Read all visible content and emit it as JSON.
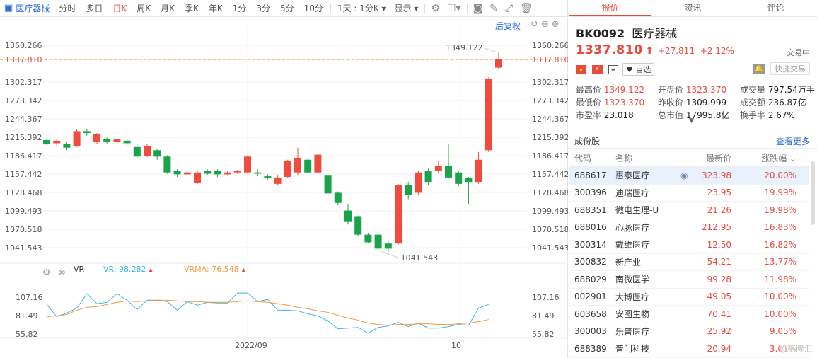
{
  "toolbar": {
    "name": "医疗器械",
    "periods": [
      "分时",
      "多日",
      "日K",
      "周K",
      "月K",
      "季K",
      "年K",
      "1分",
      "3分",
      "5分",
      "10分"
    ],
    "active_period": "日K",
    "range_select": "1天 : 1分K",
    "display": "显示"
  },
  "restore": "后复权",
  "price_axis": {
    "labels": [
      "1360.266",
      "1337.810",
      "1302.317",
      "1273.342",
      "1244.367",
      "1215.392",
      "1186.417",
      "1157.442",
      "1128.468",
      "1099.493",
      "1070.518",
      "1041.543"
    ],
    "min": 1041.543,
    "max": 1360.266,
    "current": "1337.810"
  },
  "annotations": {
    "high": "1349.122",
    "low": "1041.543"
  },
  "candles": [
    [
      1211,
      1205,
      1213,
      1203
    ],
    [
      1206,
      1210,
      1213,
      1202
    ],
    [
      1205,
      1199,
      1208,
      1195
    ],
    [
      1202,
      1225,
      1228,
      1200
    ],
    [
      1225,
      1222,
      1228,
      1218
    ],
    [
      1208,
      1220,
      1222,
      1205
    ],
    [
      1213,
      1208,
      1215,
      1205
    ],
    [
      1208,
      1212,
      1214,
      1205
    ],
    [
      1210,
      1206,
      1213,
      1202
    ],
    [
      1200,
      1185,
      1205,
      1182
    ],
    [
      1186,
      1201,
      1205,
      1184
    ],
    [
      1195,
      1185,
      1197,
      1180
    ],
    [
      1185,
      1160,
      1187,
      1158
    ],
    [
      1162,
      1157,
      1165,
      1153
    ],
    [
      1157,
      1160,
      1162,
      1155
    ],
    [
      1143,
      1160,
      1162,
      1142
    ],
    [
      1162,
      1158,
      1165,
      1155
    ],
    [
      1162,
      1157,
      1165,
      1153
    ],
    [
      1157,
      1160,
      1162,
      1155
    ],
    [
      1160,
      1163,
      1164,
      1158
    ],
    [
      1160,
      1185,
      1187,
      1158
    ],
    [
      1160,
      1158,
      1165,
      1154
    ],
    [
      1154,
      1151,
      1157,
      1149
    ],
    [
      1142,
      1152,
      1155,
      1140
    ],
    [
      1153,
      1178,
      1180,
      1152
    ],
    [
      1160,
      1182,
      1199,
      1155
    ],
    [
      1180,
      1160,
      1182,
      1158
    ],
    [
      1160,
      1188,
      1190,
      1158
    ],
    [
      1155,
      1127,
      1158,
      1125
    ],
    [
      1128,
      1112,
      1130,
      1108
    ],
    [
      1100,
      1082,
      1110,
      1078
    ],
    [
      1090,
      1062,
      1092,
      1060
    ],
    [
      1062,
      1050,
      1065,
      1048
    ],
    [
      1062,
      1040,
      1064,
      1036
    ],
    [
      1048,
      1040,
      1052,
      1035
    ],
    [
      1048,
      1140,
      1142,
      1046
    ],
    [
      1140,
      1125,
      1145,
      1118
    ],
    [
      1128,
      1160,
      1162,
      1125
    ],
    [
      1162,
      1145,
      1166,
      1140
    ],
    [
      1162,
      1170,
      1179,
      1158
    ],
    [
      1170,
      1152,
      1205,
      1150
    ],
    [
      1160,
      1142,
      1163,
      1138
    ],
    [
      1152,
      1145,
      1153,
      1110
    ],
    [
      1145,
      1180,
      1192,
      1142
    ],
    [
      1195,
      1308,
      1310,
      1192
    ],
    [
      1325,
      1338,
      1349,
      1323
    ]
  ],
  "vr": {
    "label": "VR",
    "vr_text": "VR: 98.282",
    "vrma_text": "VRMA: 76.548",
    "axis": [
      "107.16",
      "81.49",
      "55.82"
    ],
    "min": 55.82,
    "max": 107.16,
    "vr_values": [
      97,
      80,
      85,
      92,
      112,
      98,
      100,
      112,
      103,
      90,
      103,
      103,
      101,
      89,
      101,
      96,
      100,
      99,
      99,
      113,
      113,
      101,
      104,
      89,
      89,
      88,
      84,
      81,
      74,
      63,
      64,
      65,
      57,
      65,
      67,
      72,
      66,
      71,
      64,
      64,
      66,
      69,
      68,
      92,
      97
    ],
    "vrma_values": [
      80,
      81,
      83,
      89,
      93,
      94,
      97,
      100,
      102,
      101,
      102,
      103,
      103,
      102,
      101,
      101,
      100,
      100,
      100,
      101,
      102,
      101,
      100,
      98,
      96,
      93,
      91,
      88,
      86,
      82,
      78,
      75,
      71,
      69,
      68,
      69,
      69,
      70,
      70,
      69,
      69,
      70,
      71,
      73,
      76
    ]
  },
  "time_axis": [
    "2022/09",
    "10"
  ],
  "right": {
    "tabs": [
      "报价",
      "资讯",
      "评论"
    ],
    "code": "BK0092",
    "name": "医疗器械",
    "price": "1337.810",
    "arrow": "⬆",
    "change": "+27.811",
    "pct": "+2.12%",
    "status": "交易中",
    "watch": "自选",
    "quick_trade": "快捷交易",
    "stats": [
      {
        "k": "最高价",
        "v": "1349.122",
        "red": true
      },
      {
        "k": "开盘价",
        "v": "1323.370",
        "red": true
      },
      {
        "k": "成交量",
        "v": "797.54万手",
        "red": false
      },
      {
        "k": "最低价",
        "v": "1323.370",
        "red": true
      },
      {
        "k": "昨收价",
        "v": "1309.999",
        "red": false
      },
      {
        "k": "成交额",
        "v": "236.87亿",
        "red": false
      },
      {
        "k": "市盈率",
        "v": "23.018",
        "red": false
      },
      {
        "k": "总市值",
        "v": "17995.8亿",
        "red": false
      },
      {
        "k": "换手率",
        "v": "2.67%",
        "red": false
      }
    ],
    "components_title": "成份股",
    "more": "查看更多",
    "headers": [
      "代码",
      "名称",
      "最新价",
      "涨跌幅"
    ],
    "rows": [
      [
        "688617",
        "惠泰医疗",
        "323.98",
        "20.00%"
      ],
      [
        "300396",
        "迪瑞医疗",
        "23.95",
        "19.99%"
      ],
      [
        "688351",
        "微电生理-U",
        "21.26",
        "19.98%"
      ],
      [
        "688016",
        "心脉医疗",
        "212.95",
        "16.83%"
      ],
      [
        "300314",
        "戴维医疗",
        "12.50",
        "16.82%"
      ],
      [
        "300832",
        "新产业",
        "54.21",
        "13.77%"
      ],
      [
        "688029",
        "南微医学",
        "99.28",
        "11.98%"
      ],
      [
        "002901",
        "大博医疗",
        "49.05",
        "10.00%"
      ],
      [
        "603658",
        "安图生物",
        "70.41",
        "10.00%"
      ],
      [
        "300003",
        "乐普医疗",
        "25.92",
        "9.05%"
      ],
      [
        "688389",
        "普门科技",
        "20.94",
        "3.01%"
      ]
    ]
  },
  "watermark": "格隆汇"
}
